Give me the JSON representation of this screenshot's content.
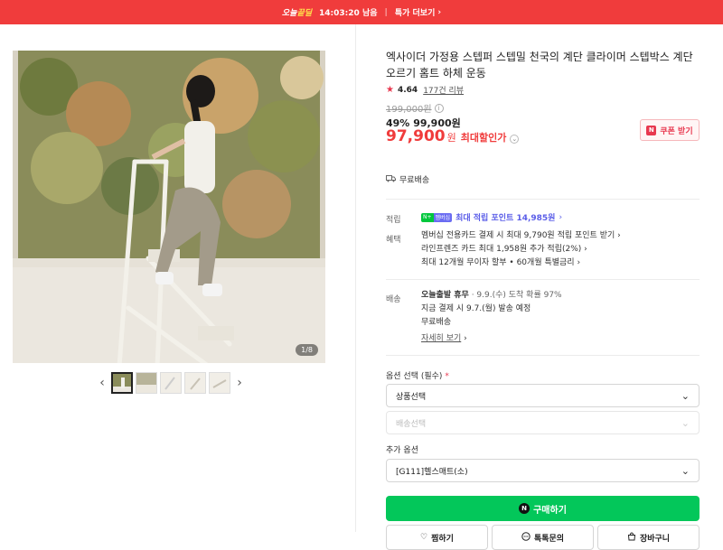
{
  "banner": {
    "brand_a": "오늘",
    "brand_b": "끝딜",
    "timer": "14:03:20",
    "timer_suffix": "남음",
    "more_label": "특가 더보기",
    "bg_color": "#f03c3c"
  },
  "gallery": {
    "page_counter": "1/8",
    "prev_icon": "chevron-left-icon",
    "next_icon": "chevron-right-icon",
    "thumb_count": 5,
    "active_thumb": 1
  },
  "product": {
    "title": "엑사이더 가정용 스텝퍼 스텝밀 천국의 계단 클라이머 스텝박스 계단오르기 홈트 하체 운동",
    "rating": "4.64",
    "reviews": "177건 리뷰",
    "original_price": "199,000원",
    "discount_pct": "49%",
    "sale_price": "99,900원",
    "final_price": "97,900",
    "final_unit": "원",
    "final_label": "최대할인가",
    "coupon_label": "쿠폰 받기",
    "shipping_free": "무료배송"
  },
  "benefits": {
    "points_label": "적립",
    "points_badge_a": "N+",
    "points_badge_b": "멤버십",
    "points_text": "최대 적립 포인트 14,985원",
    "perks_label": "혜택",
    "perks": [
      "멤버십 전용카드 결제 시 최대 9,790원 적립 포인트 받기",
      "라인프렌즈 카드 최대 1,958원 추가 적립(2%)",
      "최대 12개월 무이자 할부 • 60개월 특별금리"
    ]
  },
  "delivery": {
    "label": "배송",
    "line1_strong": "오늘출발 휴무",
    "line1_rest": "· 9.9.(수) 도착 확률 97%",
    "line2": "지금 결제 시 9.7.(월) 발송 예정",
    "line3": "무료배송",
    "details_link": "자세히 보기"
  },
  "options": {
    "required_label": "옵션 선택 (필수)",
    "required_mark": "*",
    "product_select": "상품선택",
    "delivery_select": "배송선택",
    "extra_label": "추가 옵션",
    "extra_select": "[G111]헬스매트(소)"
  },
  "actions": {
    "buy": "구매하기",
    "wish": "찜하기",
    "talk": "톡톡문의",
    "cart": "장바구니",
    "buy_color": "#03c75a"
  }
}
